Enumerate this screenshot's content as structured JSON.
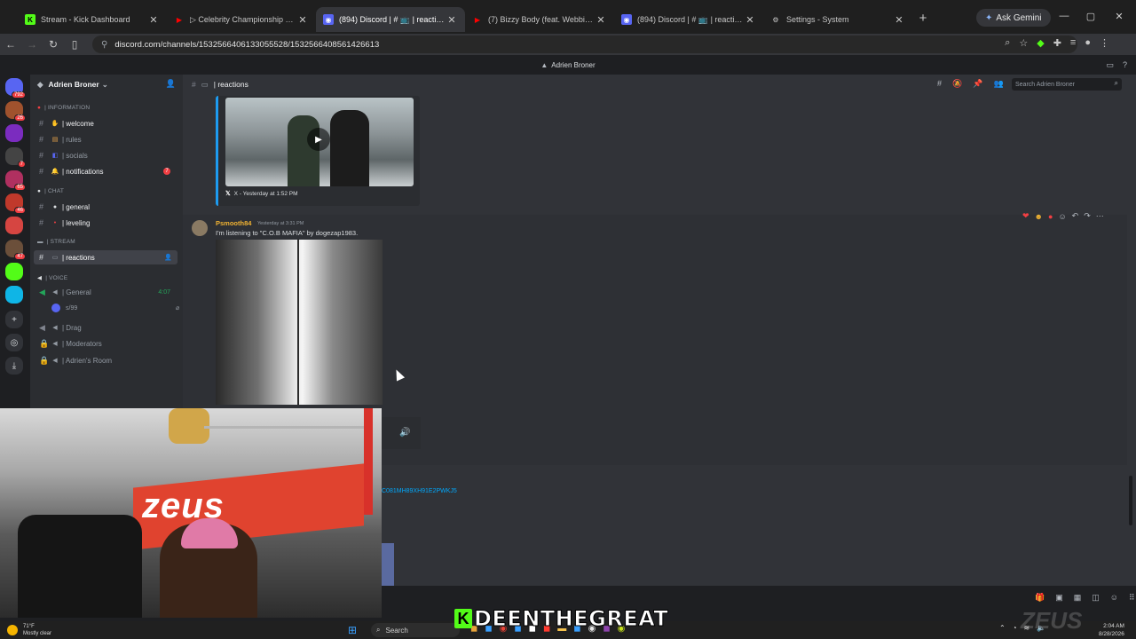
{
  "browser": {
    "tabs": [
      {
        "title": "Stream - Kick Dashboard",
        "icon": "kick-icon",
        "color": "#53fc18",
        "active": false
      },
      {
        "title": "▷ Celebrity Championship Box",
        "icon": "youtube-icon",
        "color": "#ff0000",
        "active": false
      },
      {
        "title": "(894) Discord | # 📺 | reactions",
        "icon": "discord-icon",
        "color": "#5865f2",
        "active": true
      },
      {
        "title": "(7) Bizzy Body (feat. Webbie &",
        "icon": "youtube-icon",
        "color": "#ff0000",
        "active": false
      },
      {
        "title": "(894) Discord | # 📺 | reactions",
        "icon": "discord-icon",
        "color": "#5865f2",
        "active": false
      },
      {
        "title": "Settings - System",
        "icon": "gear-icon",
        "color": "#9aa0a6",
        "active": false
      }
    ],
    "ask_gemini": "Ask Gemini",
    "url": "discord.com/channels/1532566406133055528/1532566408561426613"
  },
  "discord": {
    "window_title": "Adrien Broner",
    "server_name": "Adrien Broner",
    "servers": [
      {
        "badge": "792",
        "color": "#5865f2"
      },
      {
        "badge": "26",
        "color": "#a0522d"
      },
      {
        "badge": "",
        "color": "#7b2cbf"
      },
      {
        "badge": "7",
        "color": "#444444"
      },
      {
        "badge": "65",
        "color": "#b03060"
      },
      {
        "badge": "46",
        "color": "#c0392b"
      },
      {
        "badge": "",
        "color": "#d64541"
      },
      {
        "badge": "47",
        "color": "#6b4f3a"
      },
      {
        "badge": "",
        "color": "#53fc18"
      },
      {
        "badge": "",
        "color": "#0fb5e6"
      }
    ],
    "categories": {
      "information": "| INFORMATION",
      "chat": "| CHAT",
      "stream": "| STREAM",
      "voice": "| VOICE"
    },
    "channels": {
      "welcome": "| welcome",
      "rules": "| rules",
      "socials": "| socials",
      "notifications": "| notifications",
      "notifications_mentions": "7",
      "general": "| general",
      "leveling": "| leveling",
      "reactions": "| reactions",
      "voice_general": "| General",
      "voice_general_time": "4:07",
      "voice_user": "s/99",
      "drag": "| Drag",
      "moderators": "| Moderators",
      "adriens_room": "| Adrien's Room"
    },
    "channel_header": "| reactions",
    "search_placeholder": "Search Adrien Broner",
    "embed_footer": "X - Yesterday at 1:52 PM",
    "message": {
      "author": "Psmooth84",
      "timestamp": "Yesterday at 3:31 PM",
      "text": "I'm listening to \"C.O.B MAFIA\" by dogezap1983."
    },
    "link_fragment": "C081MH89XH91E2PWKJ5"
  },
  "stream": {
    "banner_text": "zeus",
    "overlay_name": "DEENTHEGREAT",
    "watermark": "ZEUS"
  },
  "taskbar": {
    "weather_temp": "71°F",
    "weather_desc": "Mostly clear",
    "search_label": "Search",
    "time": "2:04 AM",
    "date": "8/28/2026"
  }
}
